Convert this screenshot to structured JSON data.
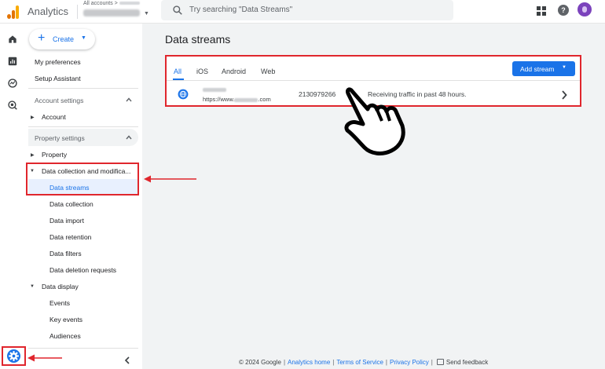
{
  "header": {
    "app_name": "Analytics",
    "account_crumb": "All accounts >",
    "search_placeholder": "Try searching \"Data Streams\""
  },
  "sidebar": {
    "create_label": "Create",
    "my_preferences": "My preferences",
    "setup_assistant": "Setup Assistant",
    "account_settings": "Account settings",
    "account": "Account",
    "property_settings": "Property settings",
    "property": "Property",
    "data_collection": "Data collection and modifica...",
    "data_streams": "Data streams",
    "data_collection_sub": "Data collection",
    "data_import": "Data import",
    "data_retention": "Data retention",
    "data_filters": "Data filters",
    "data_deletion": "Data deletion requests",
    "data_display": "Data display",
    "events": "Events",
    "key_events": "Key events",
    "audiences": "Audiences"
  },
  "main": {
    "title": "Data streams",
    "tabs": [
      "All",
      "iOS",
      "Android",
      "Web"
    ],
    "add_stream_label": "Add stream",
    "stream": {
      "url_prefix": "https://www.",
      "url_suffix": ".com",
      "id": "2130979266",
      "status": "Receiving traffic in past 48 hours."
    }
  },
  "footer": {
    "copyright": "© 2024 Google",
    "links": [
      "Analytics home",
      "Terms of Service",
      "Privacy Policy"
    ],
    "feedback": "Send feedback"
  },
  "colors": {
    "accent": "#1a73e8",
    "highlight": "#e0262d",
    "logo_orange": "#e37400",
    "logo_yellow": "#f9ab00"
  },
  "icons": {
    "rail": [
      "home-icon",
      "reports-icon",
      "explore-icon",
      "advertising-icon",
      "admin-gear-icon"
    ],
    "header": [
      "search-icon",
      "apps-grid-icon",
      "help-icon"
    ]
  }
}
